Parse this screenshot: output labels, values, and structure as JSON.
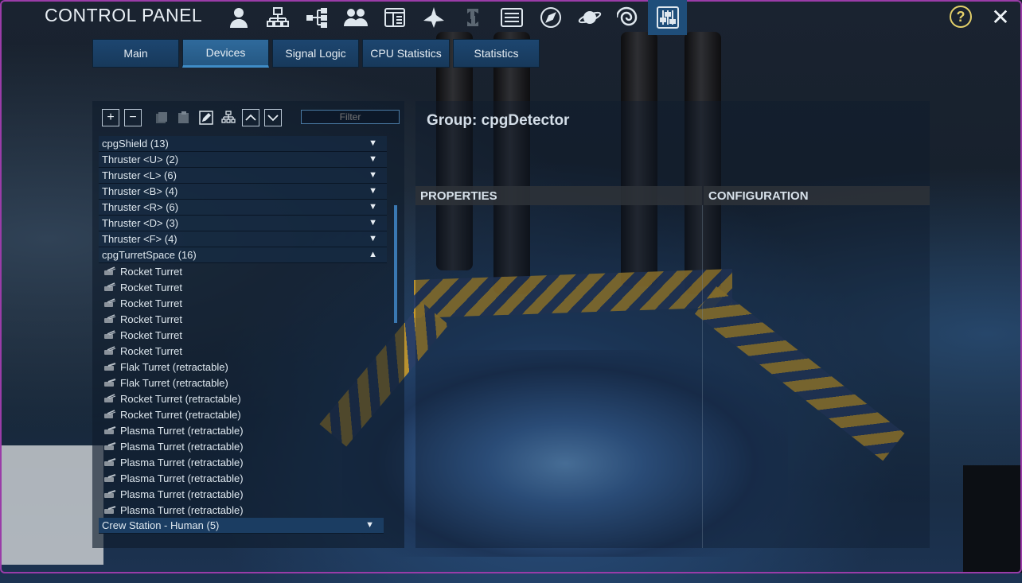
{
  "header": {
    "title": "CONTROL PANEL",
    "icons": [
      "player-icon",
      "structure-icon",
      "hierarchy-icon",
      "faction-icon",
      "registry-icon",
      "ship-icon",
      "transfer-icon",
      "list-icon",
      "compass-icon",
      "planet-icon",
      "galaxy-icon",
      "sliders-icon"
    ],
    "active_icon": "sliders-icon",
    "help_label": "?",
    "close_label": "✕"
  },
  "tabs": [
    {
      "label": "Main"
    },
    {
      "label": "Devices"
    },
    {
      "label": "Signal Logic"
    },
    {
      "label": "CPU Statistics"
    },
    {
      "label": "Statistics"
    }
  ],
  "active_tab": "Devices",
  "device_panel": {
    "toolbar": {
      "add_label": "+",
      "remove_label": "−"
    },
    "filter_placeholder": "Filter",
    "rows": [
      {
        "label": "cpgShield (13)",
        "type": "group",
        "arrow": "▼"
      },
      {
        "label": "Thruster <U> (2)",
        "type": "group",
        "arrow": "▼"
      },
      {
        "label": "Thruster <L> (6)",
        "type": "group",
        "arrow": "▼"
      },
      {
        "label": "Thruster <B> (4)",
        "type": "group",
        "arrow": "▼"
      },
      {
        "label": "Thruster <R> (6)",
        "type": "group",
        "arrow": "▼"
      },
      {
        "label": "Thruster <D> (3)",
        "type": "group",
        "arrow": "▼"
      },
      {
        "label": "Thruster <F> (4)",
        "type": "group",
        "arrow": "▼"
      },
      {
        "label": "cpgTurretSpace (16)",
        "type": "group",
        "arrow": "▲"
      },
      {
        "label": "Rocket Turret",
        "type": "item",
        "icon": "rocket-turret-icon"
      },
      {
        "label": "Rocket Turret",
        "type": "item",
        "icon": "rocket-turret-icon"
      },
      {
        "label": "Rocket Turret",
        "type": "item",
        "icon": "rocket-turret-icon"
      },
      {
        "label": "Rocket Turret",
        "type": "item",
        "icon": "rocket-turret-icon"
      },
      {
        "label": "Rocket Turret",
        "type": "item",
        "icon": "rocket-turret-icon"
      },
      {
        "label": "Rocket Turret",
        "type": "item",
        "icon": "rocket-turret-icon"
      },
      {
        "label": "Flak Turret (retractable)",
        "type": "item",
        "icon": "retractable-turret-icon"
      },
      {
        "label": "Flak Turret (retractable)",
        "type": "item",
        "icon": "retractable-turret-icon"
      },
      {
        "label": "Rocket Turret (retractable)",
        "type": "item",
        "icon": "rocket-turret-icon"
      },
      {
        "label": "Rocket Turret (retractable)",
        "type": "item",
        "icon": "rocket-turret-icon"
      },
      {
        "label": "Plasma Turret (retractable)",
        "type": "item",
        "icon": "retractable-turret-icon"
      },
      {
        "label": "Plasma Turret (retractable)",
        "type": "item",
        "icon": "retractable-turret-icon"
      },
      {
        "label": "Plasma Turret (retractable)",
        "type": "item",
        "icon": "retractable-turret-icon"
      },
      {
        "label": "Plasma Turret (retractable)",
        "type": "item",
        "icon": "retractable-turret-icon"
      },
      {
        "label": "Plasma Turret (retractable)",
        "type": "item",
        "icon": "retractable-turret-icon"
      },
      {
        "label": "Plasma Turret (retractable)",
        "type": "item",
        "icon": "retractable-turret-icon"
      },
      {
        "label": "Crew Station - Human (5)",
        "type": "group",
        "arrow": "▼",
        "selected": true
      }
    ]
  },
  "details": {
    "group_title": "Group: cpgDetector",
    "properties_label": "PROPERTIES",
    "configuration_label": "CONFIGURATION"
  },
  "colors": {
    "accent": "#2f6a9c",
    "frame": "#9a3ca8",
    "help": "#e4d06a"
  }
}
